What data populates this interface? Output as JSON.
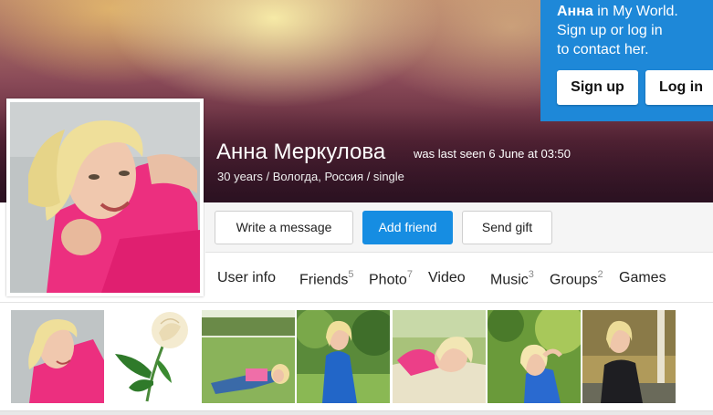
{
  "cover": {
    "login_box": {
      "name": "Анна",
      "line1_suffix": " in My World.",
      "line2": "Sign up or log in",
      "line3": "to contact her.",
      "signup_label": "Sign up",
      "login_label": "Log in"
    }
  },
  "profile": {
    "name": "Анна Меркулова",
    "last_seen": "was last seen 6 June at 03:50",
    "details": "30 years / Вологда, Россия / single"
  },
  "actions": {
    "write_message": "Write a message",
    "add_friend": "Add friend",
    "send_gift": "Send gift"
  },
  "tabs": [
    {
      "label": "User info",
      "count": ""
    },
    {
      "label": "Friends",
      "count": "5"
    },
    {
      "label": "Photo",
      "count": "7"
    },
    {
      "label": "Video",
      "count": ""
    },
    {
      "label": "Music",
      "count": "3"
    },
    {
      "label": "Groups",
      "count": "2"
    },
    {
      "label": "Games",
      "count": ""
    }
  ],
  "photos": [
    {
      "subject": "woman-pink-top-selfie"
    },
    {
      "subject": "white-rose"
    },
    {
      "subject": "woman-lying-on-grass"
    },
    {
      "subject": "woman-blue-dress-garden"
    },
    {
      "subject": "woman-lying-on-blanket"
    },
    {
      "subject": "woman-blue-dress-sunny"
    },
    {
      "subject": "woman-dark-jacket-autumn"
    }
  ],
  "colors": {
    "accent_blue": "#168de2",
    "login_box_blue": "#1e88d8"
  }
}
